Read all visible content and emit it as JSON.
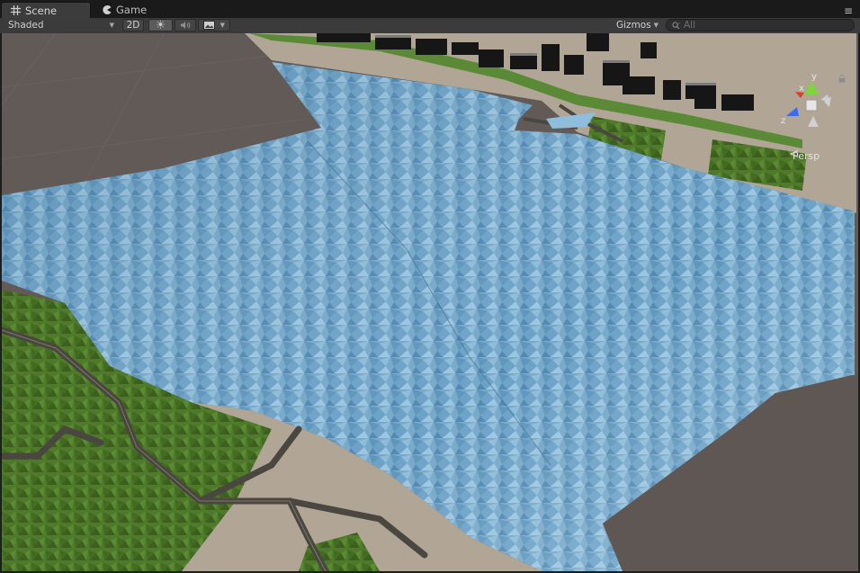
{
  "tabs": [
    {
      "label": "Scene",
      "icon": "grid-icon",
      "active": true
    },
    {
      "label": "Game",
      "icon": "pacman-icon",
      "active": false
    }
  ],
  "toolbar": {
    "shading_mode": "Shaded",
    "mode_2d_label": "2D",
    "lighting_icon": "sun-icon",
    "audio_icon": "speaker-icon",
    "effects_icon": "image-icon",
    "gizmos_label": "Gizmos",
    "search_placeholder": "All"
  },
  "scene_gizmo": {
    "y_label": "y",
    "x_label": "x",
    "z_label": "z",
    "projection_label": "Persp"
  },
  "colors": {
    "water": "#74a7c8",
    "grass": "#4f7a2a",
    "sand": "#b1a595",
    "road": "#4a4640",
    "background": "#625a57",
    "axis_x": "#e03a2a",
    "axis_y": "#7fd63a",
    "axis_z": "#3a6cf0"
  }
}
